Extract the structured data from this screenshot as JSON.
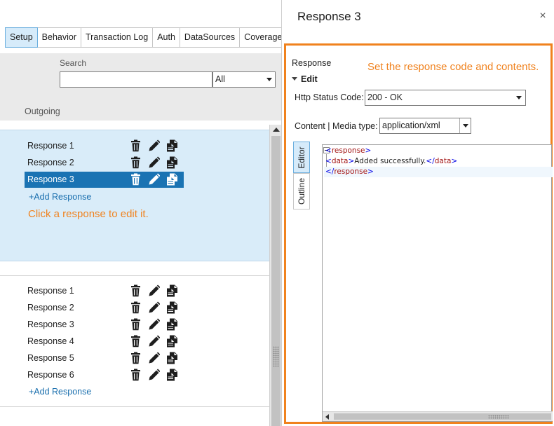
{
  "tabs": [
    "Setup",
    "Behavior",
    "Transaction Log",
    "Auth",
    "DataSources",
    "Coverage"
  ],
  "active_tab": "Setup",
  "search": {
    "label": "Search",
    "value": ""
  },
  "filter": {
    "selected": "All"
  },
  "section_label": "Outgoing",
  "group1": {
    "responses": [
      "Response 1",
      "Response 2",
      "Response 3"
    ],
    "selected": "Response 3",
    "add_label": "+Add Response",
    "hint": "Click a response to edit it."
  },
  "group2": {
    "responses": [
      "Response 1",
      "Response 2",
      "Response 3",
      "Response 4",
      "Response 5",
      "Response 6"
    ],
    "add_label": "+Add Response"
  },
  "row_icons": [
    "trash-icon",
    "pencil-icon",
    "copy-icon"
  ],
  "panel": {
    "title": "Response 3",
    "close_glyph": "×",
    "response_label": "Response",
    "hint": "Set the response code and contents.",
    "edit_label": "Edit",
    "status_label": "Http Status Code:",
    "status_value": "200 - OK",
    "media_label": "Content | Media type:",
    "media_value": "application/xml",
    "editor_tabs": [
      "Editor",
      "Outline"
    ],
    "active_editor_tab": "Editor",
    "code": {
      "open_tag": "response",
      "data_tag": "data",
      "data_text": "Added successfully.",
      "close_tag": "response"
    }
  },
  "colors": {
    "accent_orange": "#f0821e",
    "selection_blue": "#1a73b3",
    "group_bg": "#d9ecf9",
    "link_blue": "#1a6fae"
  }
}
